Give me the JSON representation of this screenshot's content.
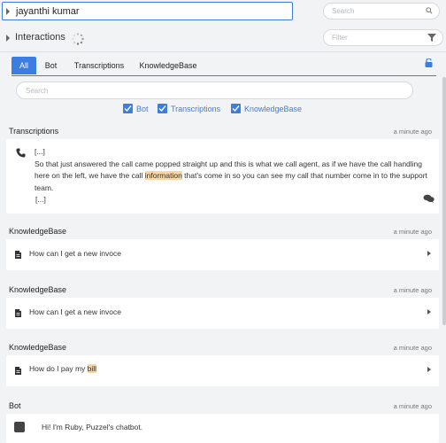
{
  "header": {
    "caller_name": "jayanthi kumar",
    "search_placeholder": "Search"
  },
  "interactions": {
    "label": "Interactions",
    "filter_placeholder": "Filter"
  },
  "tabs": [
    {
      "label": "All",
      "active": true
    },
    {
      "label": "Bot"
    },
    {
      "label": "Transcriptions"
    },
    {
      "label": "KnowledgeBase"
    }
  ],
  "search": {
    "placeholder": "Search"
  },
  "filters": [
    {
      "label": "Bot",
      "checked": true
    },
    {
      "label": "Transcriptions",
      "checked": true
    },
    {
      "label": "KnowledgeBase",
      "checked": true
    }
  ],
  "feed": {
    "transcription": {
      "section": "Transcriptions",
      "time": "a minute ago",
      "line1": "[...]",
      "body_before": "So that just answered the call came popped straight up and this is what we call agent, as if we have the call handling here on the left, we have the call ",
      "body_highlight": "information",
      "body_after": " that's come in so you can see my call that number come in to the support team.",
      "line_end": "[...]"
    },
    "kb1": {
      "section": "KnowledgeBase",
      "time": "a minute ago",
      "text": "How can I get a new invoce"
    },
    "kb2": {
      "section": "KnowledgeBase",
      "time": "a minute ago",
      "text": "How can I get a new invoce"
    },
    "kb3": {
      "section": "KnowledgeBase",
      "time": "a minute ago",
      "text_before": "How do I pay my ",
      "text_highlight": "bill"
    },
    "bot": {
      "section": "Bot",
      "time": "a minute ago",
      "text": "Hi! I'm Ruby, Puzzel's chatbot."
    }
  },
  "colors": {
    "accent": "#3b7de0",
    "highlight": "#fbd6a0",
    "background": "#f2f3f5"
  }
}
